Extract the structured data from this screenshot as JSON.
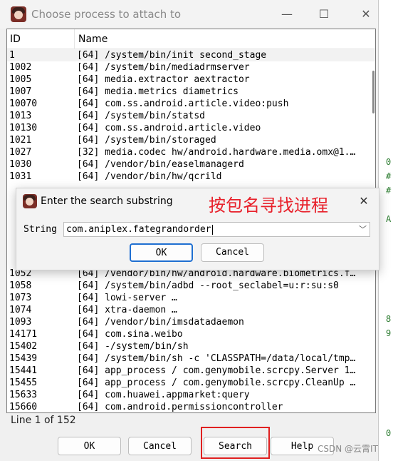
{
  "window": {
    "title": "Choose process to attach to",
    "minimize_glyph": "—",
    "maximize_glyph": "☐",
    "close_glyph": "✕"
  },
  "table": {
    "columns": [
      "ID",
      "Name"
    ],
    "rows": [
      {
        "id": "1",
        "name": "[64] /system/bin/init second_stage"
      },
      {
        "id": "1002",
        "name": "[64] /system/bin/mediadrmserver"
      },
      {
        "id": "1005",
        "name": "[64] media.extractor aextractor"
      },
      {
        "id": "1007",
        "name": "[64] media.metrics diametrics"
      },
      {
        "id": "10070",
        "name": "[64] com.ss.android.article.video:push"
      },
      {
        "id": "1013",
        "name": "[64] /system/bin/statsd"
      },
      {
        "id": "10130",
        "name": "[64] com.ss.android.article.video"
      },
      {
        "id": "1021",
        "name": "[64] /system/bin/storaged"
      },
      {
        "id": "1027",
        "name": "[32] media.codec hw/android.hardware.media.omx@1.…"
      },
      {
        "id": "1030",
        "name": "[64] /vendor/bin/easelmanagerd"
      },
      {
        "id": "1031",
        "name": "[64] /vendor/bin/hw/qcrild"
      },
      {
        "id": "",
        "name": ""
      },
      {
        "id": "",
        "name": ""
      },
      {
        "id": "",
        "name": ""
      },
      {
        "id": "",
        "name": ""
      },
      {
        "id": "",
        "name": ""
      },
      {
        "id": "",
        "name": ""
      },
      {
        "id": "",
        "name": ""
      },
      {
        "id": "1052",
        "name": "[64] /vendor/bin/hw/android.hardware.biometrics.f…"
      },
      {
        "id": "1058",
        "name": "[64] /system/bin/adbd --root_seclabel=u:r:su:s0"
      },
      {
        "id": "1073",
        "name": "[64] lowi-server …"
      },
      {
        "id": "1074",
        "name": "[64] xtra-daemon …"
      },
      {
        "id": "1093",
        "name": "[64] /vendor/bin/imsdatadaemon"
      },
      {
        "id": "14171",
        "name": "[64] com.sina.weibo"
      },
      {
        "id": "15402",
        "name": "[64] -/system/bin/sh"
      },
      {
        "id": "15439",
        "name": "[64] /system/bin/sh -c 'CLASSPATH=/data/local/tmp…"
      },
      {
        "id": "15441",
        "name": "[64] app_process / com.genymobile.scrcpy.Server 1…"
      },
      {
        "id": "15455",
        "name": "[64] app_process / com.genymobile.scrcpy.CleanUp …"
      },
      {
        "id": "15633",
        "name": "[64] com.huawei.appmarket:query"
      },
      {
        "id": "15660",
        "name": "[64] com.android.permissioncontroller"
      }
    ]
  },
  "status": "Line 1 of 152",
  "buttons": {
    "ok": "OK",
    "cancel": "Cancel",
    "search": "Search",
    "help": "Help"
  },
  "dialog": {
    "title": "Enter the search substring",
    "annotation": "按包名寻找进程",
    "label": "String",
    "value": "com.aniplex.fategrandorder",
    "ok": "OK",
    "cancel": "Cancel",
    "close_glyph": "✕",
    "dropdown_glyph": "﹀"
  },
  "watermark": "CSDN @云霄IT",
  "colors": {
    "annotation_red": "#e8202a",
    "highlight_red": "#e02020",
    "focus_blue": "#1f6fd1"
  }
}
